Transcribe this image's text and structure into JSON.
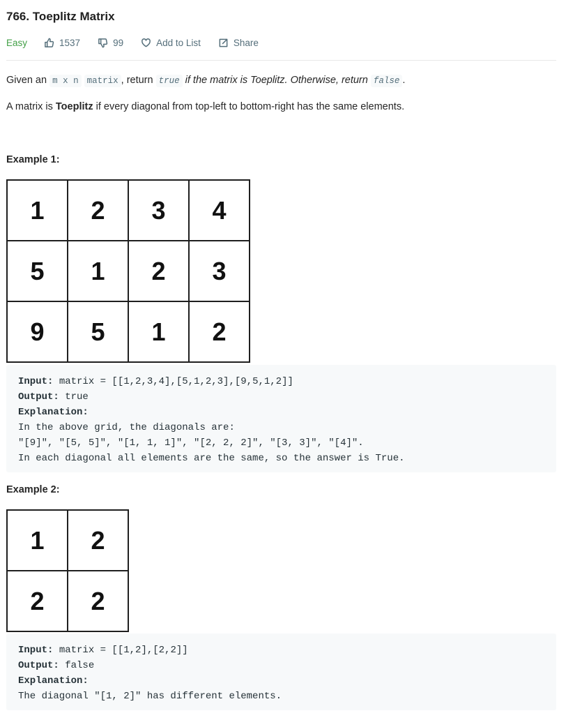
{
  "problem": {
    "title": "766. Toeplitz Matrix",
    "difficulty": "Easy",
    "likes": "1537",
    "dislikes": "99",
    "add_to_list": "Add to List",
    "share": "Share"
  },
  "description": {
    "p1": {
      "t1": "Given an ",
      "c1": "m x n",
      "t2": " ",
      "c2": "matrix",
      "t3": ", return ",
      "c3": "true",
      "t4": " if the matrix is Toeplitz. Otherwise, return ",
      "c4": "false",
      "t5": "."
    },
    "p2": {
      "t1": "A matrix is ",
      "bold": "Toeplitz",
      "t2": " if every diagonal from top-left to bottom-right has the same elements."
    }
  },
  "examples": [
    {
      "label": "Example 1:",
      "grid": [
        [
          "1",
          "2",
          "3",
          "4"
        ],
        [
          "5",
          "1",
          "2",
          "3"
        ],
        [
          "9",
          "5",
          "1",
          "2"
        ]
      ],
      "input_label": "Input:",
      "input_value": " matrix = [[1,2,3,4],[5,1,2,3],[9,5,1,2]]",
      "output_label": "Output:",
      "output_value": " true",
      "explanation_label": "Explanation:",
      "explanation_lines": [
        "In the above grid, the diagonals are:",
        "\"[9]\", \"[5, 5]\", \"[1, 1, 1]\", \"[2, 2, 2]\", \"[3, 3]\", \"[4]\".",
        "In each diagonal all elements are the same, so the answer is True."
      ]
    },
    {
      "label": "Example 2:",
      "grid": [
        [
          "1",
          "2"
        ],
        [
          "2",
          "2"
        ]
      ],
      "input_label": "Input:",
      "input_value": " matrix = [[1,2],[2,2]]",
      "output_label": "Output:",
      "output_value": " false",
      "explanation_label": "Explanation:",
      "explanation_lines": [
        "The diagonal \"[1, 2]\" has different elements."
      ]
    }
  ]
}
